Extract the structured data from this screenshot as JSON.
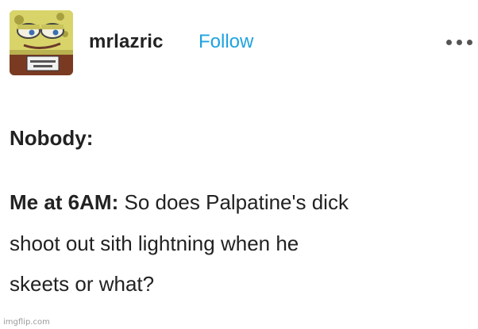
{
  "post": {
    "username": "mrlazric",
    "follow_label": "Follow",
    "more_icon": "more-horizontal-icon",
    "avatar_icon": "spongebob-avatar-icon",
    "body": {
      "line1": "Nobody:",
      "speaker": "Me at 6AM:",
      "line2_rest": " So does Palpatine's dick",
      "line3": "shoot out sith lightning when he",
      "line4": "skeets or what?"
    }
  },
  "watermark": "imgflip.com",
  "colors": {
    "follow": "#1fa3e0",
    "text": "#222222",
    "watermark": "#9a9a9a"
  }
}
